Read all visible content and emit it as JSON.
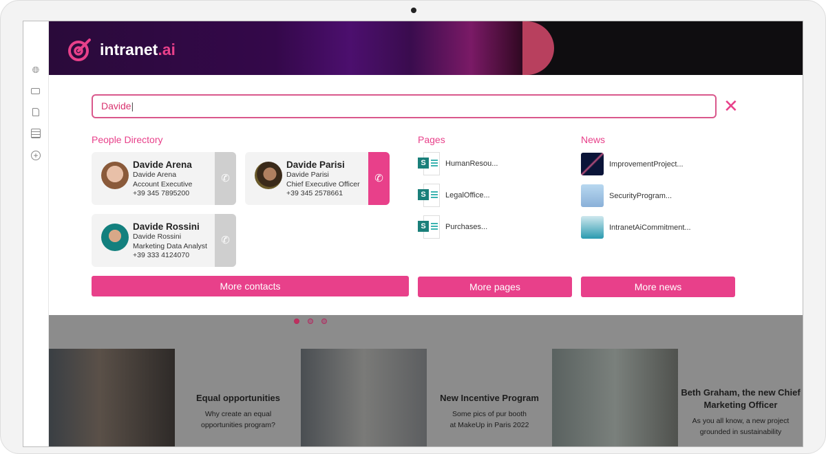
{
  "brand": {
    "name": "intranet",
    "suffix": ".ai",
    "accent": "#e8408a"
  },
  "sidebar": {
    "icons": [
      "globe-icon",
      "id-card-icon",
      "document-icon",
      "database-icon",
      "add-circle-icon"
    ]
  },
  "search": {
    "value": "Davide"
  },
  "people": {
    "title": "People Directory",
    "contacts": [
      {
        "name": "Davide Arena",
        "display": "Davide Arena",
        "role": "Account Executive",
        "phone": "+39 345 7895200"
      },
      {
        "name": "Davide Parisi",
        "display": "Davide Parisi",
        "role": "Chief Executive Officer",
        "phone": "+39 345 2578661"
      },
      {
        "name": "Davide Rossini",
        "display": "Davide Rossini",
        "role": "Marketing Data Analyst",
        "phone": "+39 333 4124070"
      }
    ],
    "more": "More contacts"
  },
  "pages": {
    "title": "Pages",
    "items": [
      "HumanResou...",
      "LegalOffice...",
      "Purchases..."
    ],
    "more": "More pages"
  },
  "news": {
    "title": "News",
    "items": [
      "ImprovementProject...",
      "SecurityProgram...",
      "IntranetAiCommitment..."
    ],
    "more": "More news"
  },
  "carousel": {
    "active": 0,
    "count": 3,
    "cards": [
      {
        "title": "Equal opportunities",
        "text1": "Why create an equal",
        "text2": "opportunities program?"
      },
      {
        "title": "New Incentive Program",
        "text1": "Some pics of pur booth",
        "text2": "at MakeUp in Paris 2022"
      },
      {
        "title": "Beth Graham, the new Chief Marketing Officer",
        "text1": "As you all know, a new project",
        "text2": "grounded in sustainability"
      }
    ]
  }
}
